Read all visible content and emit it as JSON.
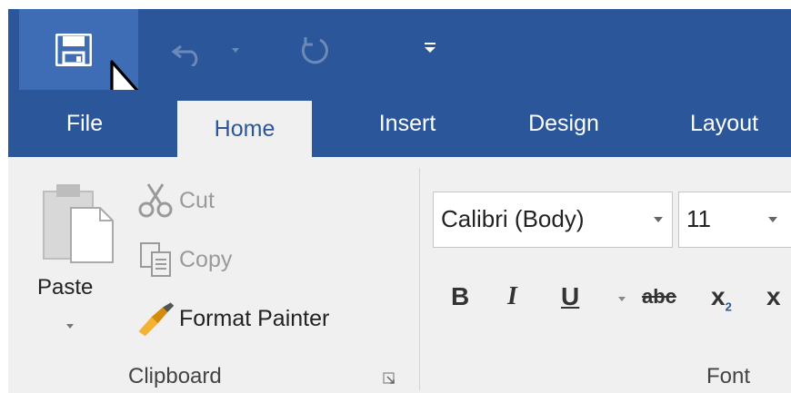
{
  "quick_access": {
    "save_icon": "save-icon",
    "undo_icon": "undo-icon",
    "redo_icon": "redo-icon",
    "customize_icon": "customize-qat-icon"
  },
  "tabs": [
    {
      "label": "File"
    },
    {
      "label": "Home"
    },
    {
      "label": "Insert"
    },
    {
      "label": "Design"
    },
    {
      "label": "Layout"
    }
  ],
  "clipboard": {
    "paste_label": "Paste",
    "cut_label": "Cut",
    "copy_label": "Copy",
    "format_painter_label": "Format Painter",
    "group_label": "Clipboard"
  },
  "font": {
    "font_name": "Calibri (Body)",
    "font_size": "11",
    "bold_label": "B",
    "italic_label": "I",
    "underline_label": "U",
    "strike_label": "abc",
    "subscript_label": "x",
    "subscript_mark": "2",
    "superscript_label": "x",
    "group_label": "Font"
  },
  "colors": {
    "ribbon_blue": "#2b579a",
    "save_hover": "#3e6db5",
    "ribbon_body": "#f0f0f0"
  }
}
